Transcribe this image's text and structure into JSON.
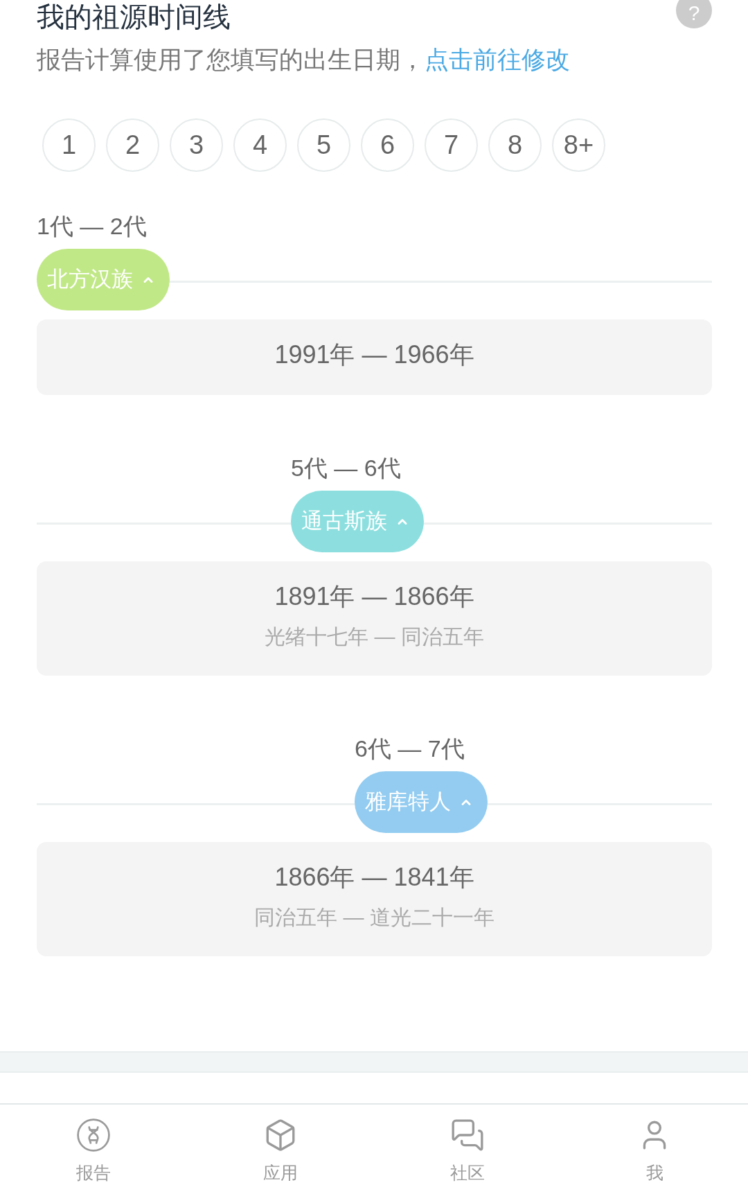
{
  "header": {
    "title": "我的祖源时间线",
    "help_button": "?",
    "note": "报告计算使用了您填写的出生日期，",
    "note_link": "点击前往修改"
  },
  "generation_filters": [
    "1",
    "2",
    "3",
    "4",
    "5",
    "6",
    "7",
    "8",
    "8+"
  ],
  "timeline": [
    {
      "generations": "1代 — 2代",
      "group": "北方汉族",
      "color": "#c1e887",
      "expanded": true,
      "years": "1991年 — 1966年"
    },
    {
      "generations": "5代 — 6代",
      "group": "通古斯族",
      "color": "#8ddfdf",
      "expanded": true,
      "years": "1891年 — 1866年",
      "reign": "光绪十七年 — 同治五年"
    },
    {
      "generations": "6代 — 7代",
      "group": "雅库特人",
      "color": "#93ccf0",
      "expanded": true,
      "years": "1866年 — 1841年",
      "reign": "同治五年 — 道光二十一年"
    }
  ],
  "bottom_nav": [
    {
      "label": "报告",
      "selected": false
    },
    {
      "label": "应用",
      "selected": false
    },
    {
      "label": "社区",
      "selected": false
    },
    {
      "label": "我",
      "selected": false
    }
  ]
}
